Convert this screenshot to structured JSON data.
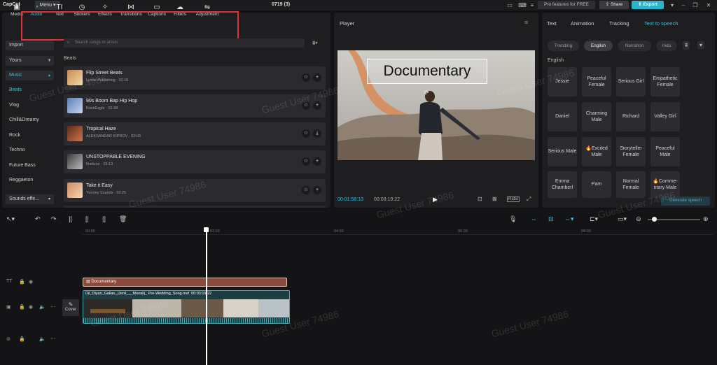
{
  "app": {
    "name": "CapCut",
    "menu": "Menu",
    "project_title": "0719 (3)",
    "pro_label": "Pro features for FREE",
    "share_label": "Share",
    "export_label": "Export"
  },
  "toolbar": {
    "items": [
      {
        "label": "Media",
        "icon": "media-icon"
      },
      {
        "label": "Audio",
        "icon": "audio-icon",
        "active": true
      },
      {
        "label": "Text",
        "icon": "text-icon"
      },
      {
        "label": "Stickers",
        "icon": "sticker-icon"
      },
      {
        "label": "Effects",
        "icon": "effects-icon"
      },
      {
        "label": "Transitions",
        "icon": "transitions-icon"
      },
      {
        "label": "Captions",
        "icon": "captions-icon"
      },
      {
        "label": "Filters",
        "icon": "filters-icon"
      },
      {
        "label": "Adjustment",
        "icon": "adjustment-icon"
      }
    ]
  },
  "sidebar": {
    "items": [
      "Import",
      "Yours",
      "Music",
      "Beats",
      "Vlog",
      "Chill&Dreamy",
      "Rock",
      "Techno",
      "Future Bass",
      "Reggaeton",
      "Sounds effe..."
    ]
  },
  "search": {
    "placeholder": "Search songs or artists"
  },
  "section": "Beats",
  "tracks": [
    {
      "title": "Flip Street Beats",
      "subtitle": "Lynne Publishing · 02:15",
      "action": "add"
    },
    {
      "title": "90s Boom Bap Hip Hop",
      "subtitle": "RockEagle · 01:38",
      "action": "add"
    },
    {
      "title": "Tropical Haze",
      "subtitle": "ALEKSANDAR KIPROV · 02:03",
      "action": "download"
    },
    {
      "title": "UNSTOPPABLE EVENING",
      "subtitle": "finetune · 03:13",
      "action": "add"
    },
    {
      "title": "Take it Easy",
      "subtitle": "Yummy Sounds · 02:25",
      "action": "add"
    }
  ],
  "player": {
    "title": "Player",
    "overlay_text": "Documentary",
    "current_time": "00:01:58:13",
    "total_time": "00:03:19:22",
    "ratio": "Ratio"
  },
  "right": {
    "tabs": [
      "Text",
      "Animation",
      "Tracking",
      "Text to speech"
    ],
    "active_tab": "Text to speech",
    "chips": [
      "Trending",
      "English",
      "Narration",
      "Indo"
    ],
    "active_chip": "English",
    "section": "English",
    "voices": [
      "Jessie",
      "Peaceful Female",
      "Serious Girl",
      "Empathetic Female",
      "Daniel",
      "Charming Male",
      "Richard",
      "Valley Girl",
      "Serious Male",
      "🔥Excited Male",
      "Storyteller Female",
      "Peaceful Male",
      "Emma Chamberl",
      "Pam",
      "Normal Female",
      "🔥Comme-ntary Male"
    ],
    "generate": "Generate speech"
  },
  "timeline": {
    "ticks": [
      "00:00",
      "02:00",
      "04:00",
      "06:00",
      "08:00"
    ],
    "text_clip": "Documentary",
    "video_clip": "Dil_Diyan_Gallan_|Jenil___Monali|_ Pre-Wedding_Song.mxf",
    "video_duration": "00:03:19:22",
    "cover_label": "Cover"
  },
  "watermark": "Guest User 74986"
}
